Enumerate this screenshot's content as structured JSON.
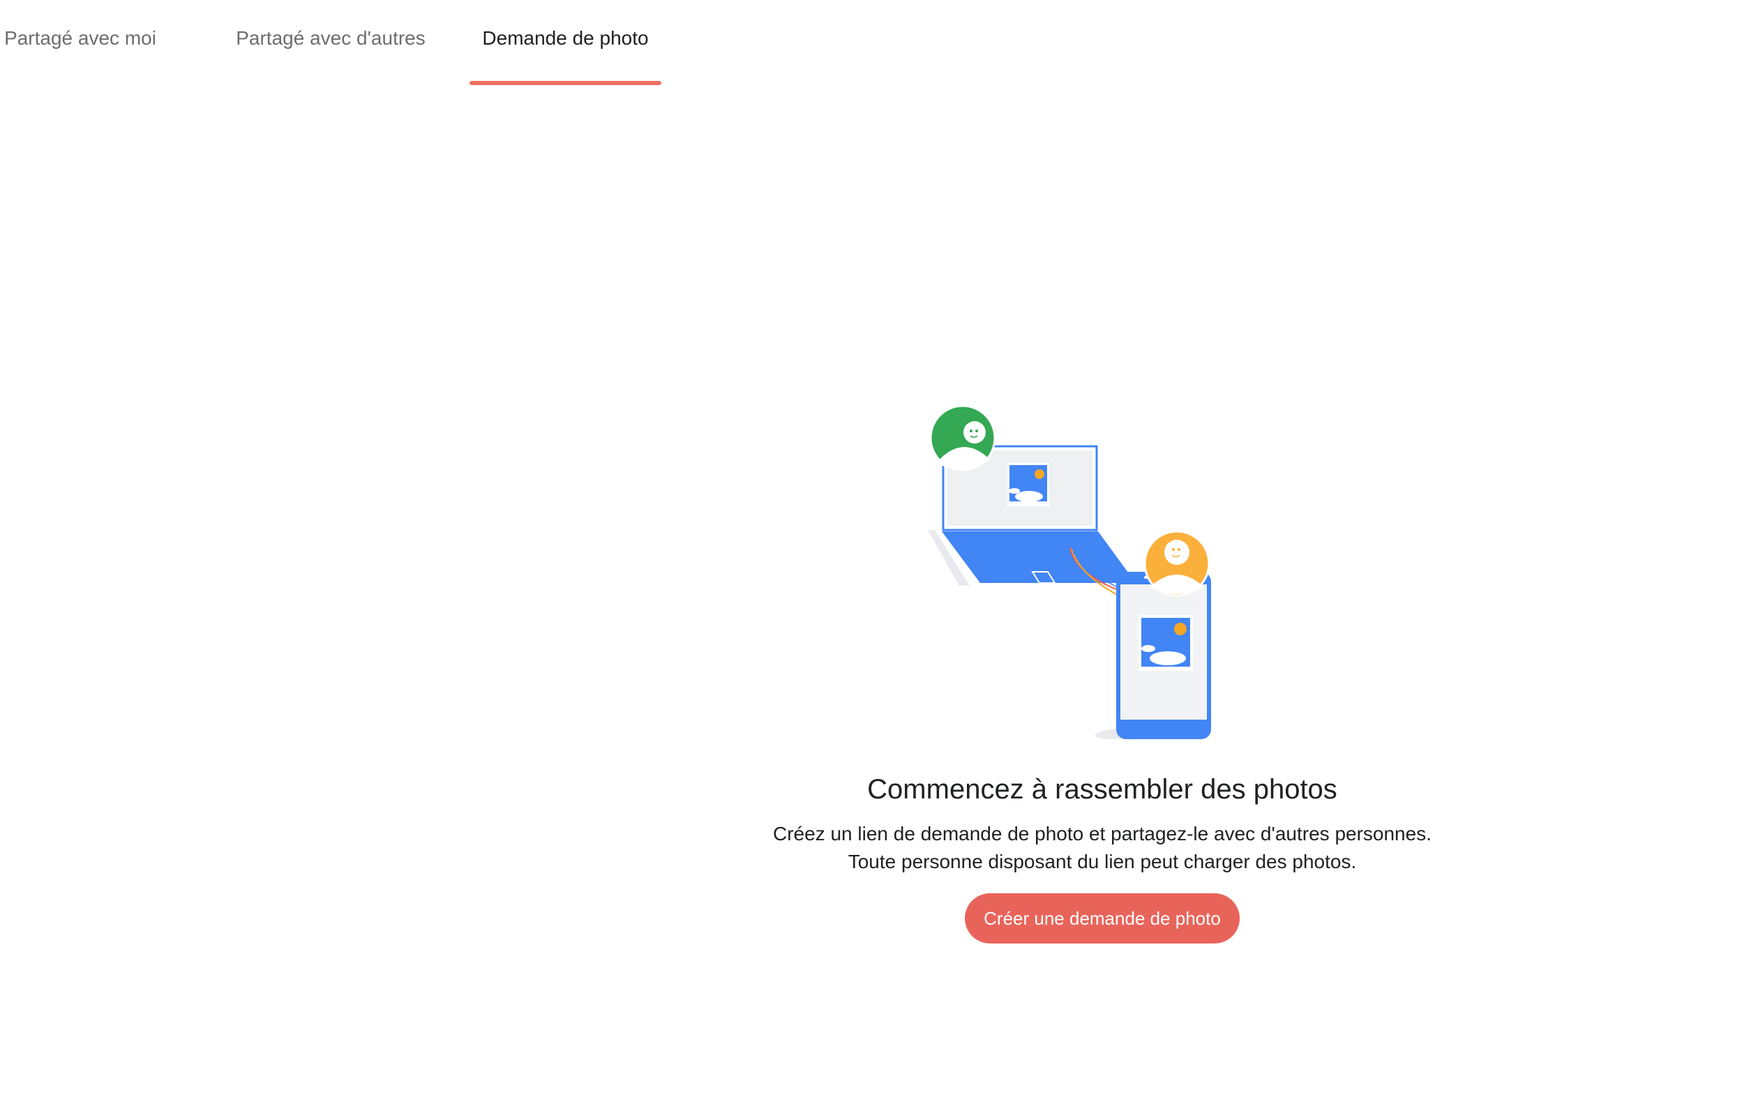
{
  "tabs": [
    {
      "label": "Partagé avec moi",
      "active": false
    },
    {
      "label": "Partagé avec d'autres",
      "active": false
    },
    {
      "label": "Demande de photo",
      "active": true
    }
  ],
  "empty_state": {
    "title": "Commencez à rassembler des photos",
    "description_line1": "Créez un lien de demande de photo et partagez-le avec d'autres personnes.",
    "description_line2": "Toute personne disposant du lien peut charger des photos.",
    "button_label": "Créer une demande de photo"
  },
  "colors": {
    "accent": "#ef6f61",
    "button": "#e8645a",
    "device_blue": "#4285f4",
    "avatar_green": "#34a853",
    "avatar_orange": "#fbb03b",
    "sun": "#f5a623"
  },
  "icons": [
    "laptop-icon",
    "phone-icon",
    "avatar-green-icon",
    "avatar-orange-icon",
    "photo-icon"
  ]
}
